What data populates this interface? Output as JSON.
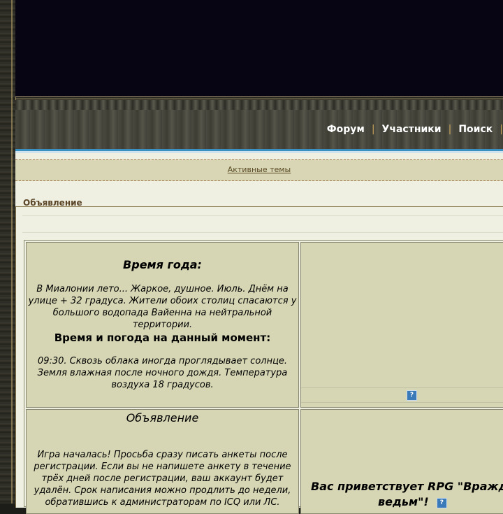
{
  "nav": {
    "items": [
      "Форум",
      "Участники",
      "Поиск"
    ],
    "separator": "|"
  },
  "active_topics": "Активные темы",
  "announcement": {
    "header": "Объявление",
    "season": {
      "title": "Время года:",
      "text": "В Миалонии лето... Жаркое, душное. Июль. Днём на улице + 32 градуса. Жители обоих столиц спасаются у большого водопада Вайенна на нейтральной территории.",
      "weather_title": "Время и погода на данный момент:",
      "weather_text": "09:30. Сквозь облака иногда проглядывает солнце. Земля влажная после ночного дождя. Температура воздуха 18 градусов."
    },
    "notice": {
      "title": "Объявление",
      "text": "Игра началась! Просьба сразу писать анкеты после регистрации. Если вы не напишете анкету в течение трёх дней после регистрации, ваш аккаунт будет удалён. Срок написания можно продлить до недели, обратившись к администраторам по ICQ или ЛС."
    },
    "welcome": {
      "line1": "Вас приветствует RPG \"Вражд",
      "line2": "ведьм\"!"
    },
    "help_icon": "?"
  },
  "colors": {
    "banner": "#070514",
    "accent_blue": "#3a90c0",
    "panel": "#d6d6b4",
    "nav_separator": "#c8a45a"
  }
}
